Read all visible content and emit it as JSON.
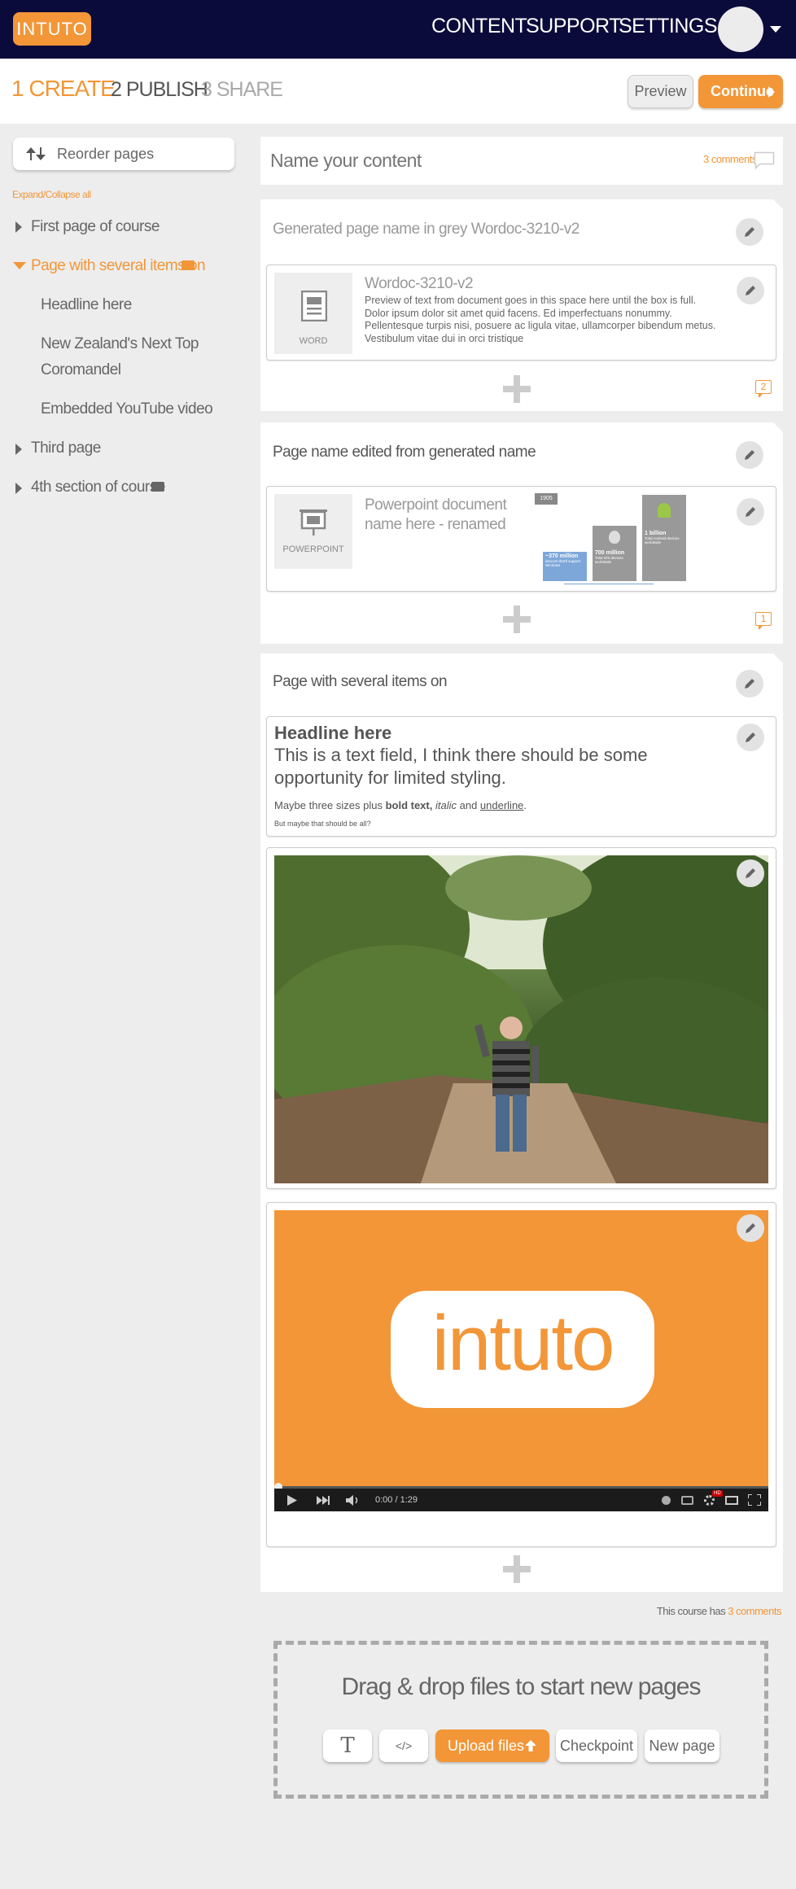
{
  "brand": {
    "logo_text": "INTUTO"
  },
  "nav": {
    "content": "CONTENT",
    "support": "SUPPORT",
    "settings": "SETTINGS"
  },
  "steps": {
    "create": "1 CREATE",
    "publish": "2 PUBLISH",
    "share": "3 SHARE"
  },
  "actions": {
    "preview": "Preview",
    "continue": "Continue"
  },
  "sidebar": {
    "reorder": "Reorder pages",
    "expand_collapse": "Expand/Collapse all",
    "items": [
      {
        "label": "First page of course"
      },
      {
        "label": "Page with several items on"
      },
      {
        "label": "Headline here"
      },
      {
        "label": "New Zealand's Next Top"
      },
      {
        "label": "Coromandel"
      },
      {
        "label": "Embedded YouTube video"
      },
      {
        "label": "Third page"
      },
      {
        "label": "4th section of course"
      }
    ]
  },
  "content_name": {
    "placeholder": "Name your content",
    "comments": "3 comments"
  },
  "pages": [
    {
      "title": "Generated page name in grey Wordoc-3210-v2",
      "item": {
        "icon_label": "WORD",
        "name": "Wordoc-3210-v2",
        "preview": "Preview of text from document goes in this space here until the box is full. Dolor ipsum dolor sit amet quid facens. Ed imperfectuans nonummy. Pellentesque turpis nisi, posuere ac ligula vitae, ullamcorper bibendum metus. Vestibulum vitae dui in orci tristique"
      },
      "comment_count": "2"
    },
    {
      "title": "Page name edited from generated name",
      "item": {
        "icon_label": "POWERPOINT",
        "name_line1": "Powerpoint document",
        "name_line2": "name here - renamed",
        "thumb": {
          "tag": "1905",
          "stat1": "~370 million",
          "stat1_sub": "devices that'll support Windows",
          "stat2": "700 million",
          "stat2_sub": "Total iOS devices worldwide",
          "stat3": "1 billion",
          "stat3_sub": "Total Android devices worldwide"
        }
      },
      "comment_count": "1"
    },
    {
      "title": "Page with several items on",
      "text_item": {
        "headline": "Headline here",
        "body_large": "This is a text field, I think there should be some opportunity for limited styling.",
        "body_small_1": "Maybe three sizes plus ",
        "bold": "bold text,",
        "italic": "italic",
        "and": " and ",
        "underline": "underline",
        "dot": ".",
        "tiny": "But maybe that should be all?"
      },
      "video": {
        "logo_text": "intuto",
        "time": "0:00 / 1:29",
        "hd_badge": "HD",
        "progress": 0
      }
    }
  ],
  "course_comments": {
    "prefix": "This course has ",
    "link": "3 comments"
  },
  "dropzone": {
    "title": "Drag & drop files to start new pages",
    "text_tool": "T",
    "code_tool": "</>",
    "upload": "Upload files",
    "checkpoint": "Checkpoint",
    "new_page": "New page"
  },
  "colors": {
    "accent": "#f29638",
    "topbar": "#0b0b3b",
    "background": "#ededed"
  }
}
